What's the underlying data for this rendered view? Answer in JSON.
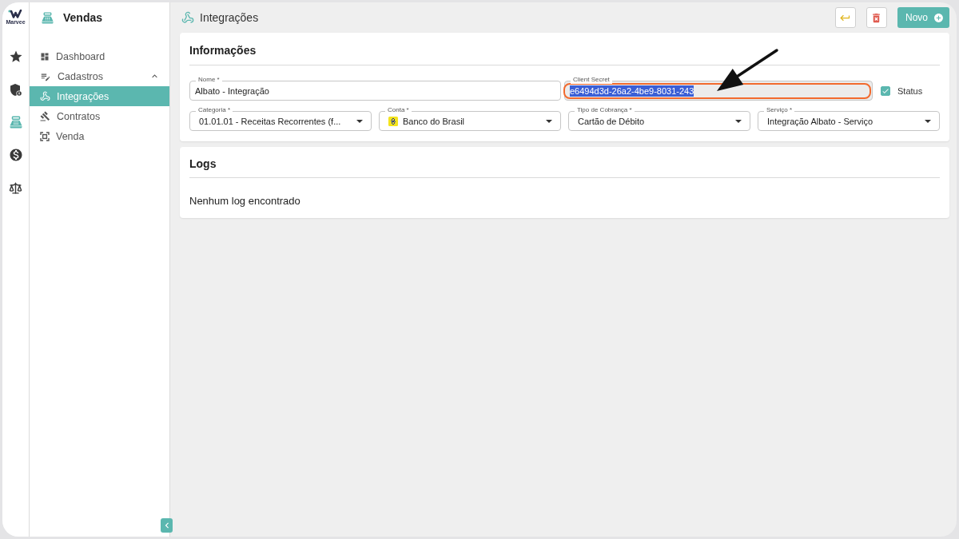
{
  "logo": {
    "text": "Marvee"
  },
  "rail": [
    {
      "kind": "star",
      "selected": false
    },
    {
      "kind": "shield",
      "selected": false
    },
    {
      "kind": "register",
      "selected": true
    },
    {
      "kind": "money",
      "selected": false
    },
    {
      "kind": "scale",
      "selected": false
    }
  ],
  "sidebar": {
    "title": "Vendas",
    "items": [
      {
        "label": "Dashboard",
        "kind": "dashboard",
        "selected": false
      },
      {
        "label": "Cadastros",
        "kind": "forms",
        "selected": false,
        "expanded": true,
        "children": [
          {
            "label": "Integrações",
            "kind": "webhook",
            "selected": true
          },
          {
            "label": "Contratos",
            "kind": "gavel",
            "selected": false
          },
          {
            "label": "Venda",
            "kind": "frame",
            "selected": false
          }
        ]
      }
    ]
  },
  "page": {
    "title": "Integrações",
    "buttons": [
      {
        "kind": "back"
      },
      {
        "kind": "delete"
      },
      {
        "kind": "new",
        "label": "Novo"
      }
    ]
  },
  "details": {
    "title": "Informações",
    "rows": [
      {
        "fields": [
          {
            "kind": "text",
            "label": "Nome *",
            "value": "Albato - Integração",
            "readonly": false,
            "text_selected": false,
            "outlined": false
          },
          {
            "kind": "text",
            "label": "Client Secret",
            "value": "e6494d3d-26a2-4be9-8031-243",
            "readonly": true,
            "text_selected": true,
            "outlined": true
          }
        ],
        "status": {
          "label": "Status",
          "checked": true
        }
      },
      {
        "fields": [
          {
            "kind": "select",
            "label": "Categoria *",
            "value": "01.01.01 - Receitas Recorrentes (f..."
          },
          {
            "kind": "account_select",
            "label": "Conta *",
            "value": "Banco do Brasil"
          },
          {
            "kind": "select",
            "label": "Tipo de Cobrança *",
            "value": "Cartão de Débito"
          },
          {
            "kind": "select",
            "label": "Serviço *",
            "value": "Integração Albato - Serviço"
          }
        ]
      }
    ]
  },
  "logs": {
    "title": "Logs",
    "empty_text": "Nenhum log encontrado"
  },
  "pointer_arrow": true
}
